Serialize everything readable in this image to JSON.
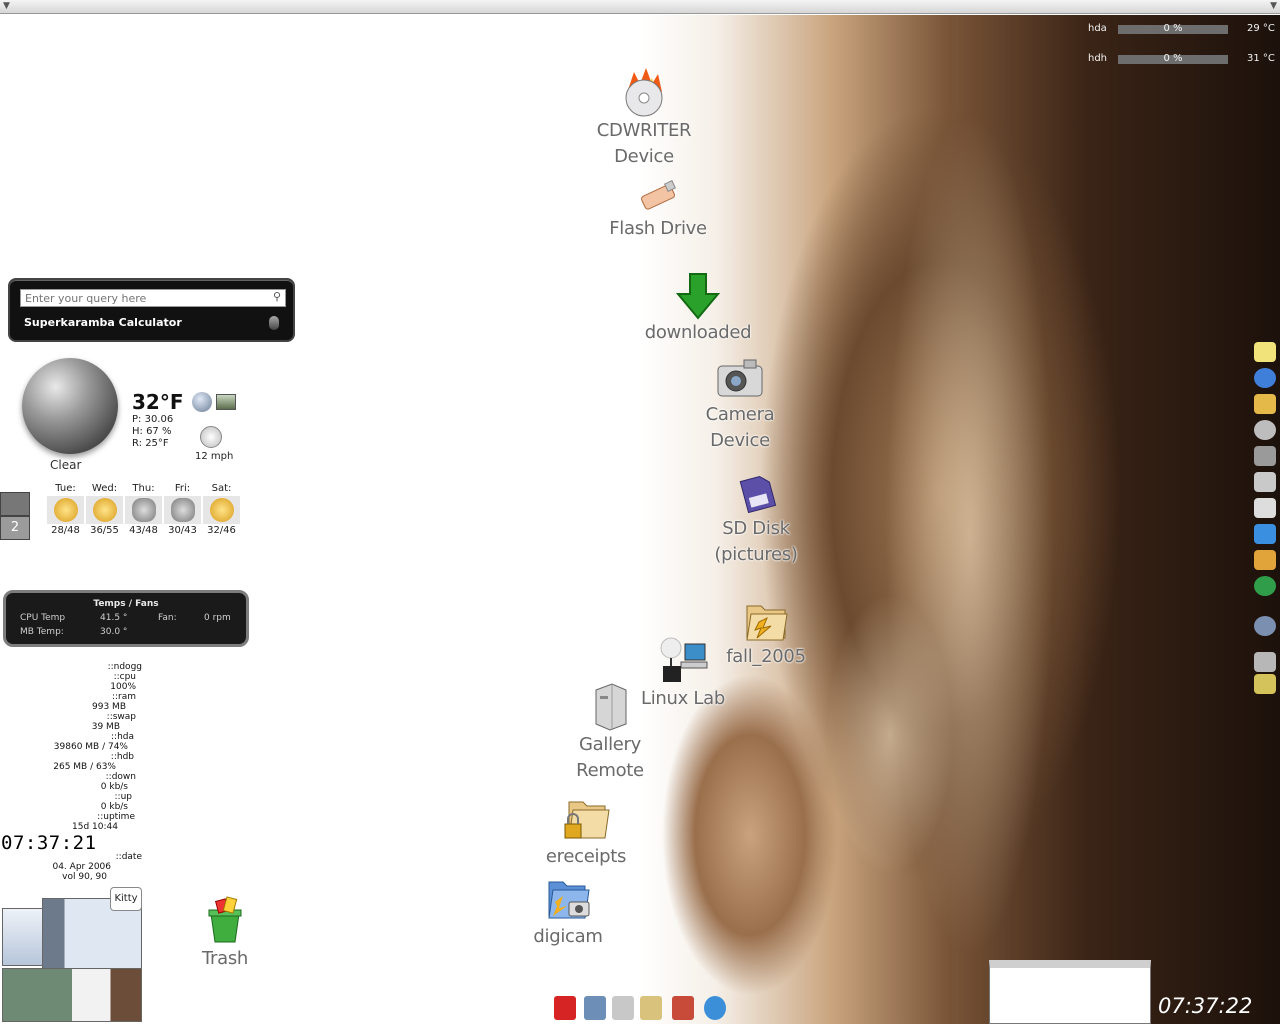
{
  "disk_monitor": [
    {
      "label": "hda",
      "percent": "0 %",
      "temp": "29 °C",
      "usage": 0
    },
    {
      "label": "hdh",
      "percent": "0 %",
      "temp": "31 °C",
      "usage": 0
    }
  ],
  "desktop_icons": [
    {
      "name": "cdwriter",
      "line1": "CDWRITER",
      "line2": "Device",
      "icon": "cd-burner-icon"
    },
    {
      "name": "flash-drive",
      "line1": "Flash Drive",
      "line2": "",
      "icon": "usb-stick-icon"
    },
    {
      "name": "downloaded",
      "line1": "downloaded",
      "line2": "",
      "icon": "download-arrow-icon"
    },
    {
      "name": "camera-device",
      "line1": "Camera",
      "line2": "Device",
      "icon": "camera-icon"
    },
    {
      "name": "sd-disk",
      "line1": "SD Disk",
      "line2": "(pictures)",
      "icon": "sd-card-icon"
    },
    {
      "name": "fall-2005",
      "line1": "fall_2005",
      "line2": "",
      "icon": "folder-icon"
    },
    {
      "name": "linux-lab",
      "line1": "Linux Lab",
      "line2": "",
      "icon": "network-computer-icon"
    },
    {
      "name": "gallery-remote",
      "line1": "Gallery",
      "line2": "Remote",
      "icon": "server-icon"
    },
    {
      "name": "ereceipts",
      "line1": "ereceipts",
      "line2": "",
      "icon": "locked-folder-icon"
    },
    {
      "name": "digicam",
      "line1": "digicam",
      "line2": "",
      "icon": "camera-folder-icon"
    },
    {
      "name": "trash",
      "line1": "Trash",
      "line2": "",
      "icon": "trash-icon"
    }
  ],
  "calculator": {
    "placeholder": "Enter your query here",
    "title": "Superkaramba Calculator"
  },
  "weather": {
    "condition": "Clear",
    "temp": "32°F",
    "pressure": "P: 30.06",
    "humidity": "H: 67 %",
    "real_feel": "R: 25°F",
    "wind": "12 mph",
    "forecast": [
      {
        "day": "Tue:",
        "range": "28/48",
        "icon": "sun-icon",
        "color": "#e2b23a"
      },
      {
        "day": "Wed:",
        "range": "36/55",
        "icon": "sun-icon",
        "color": "#e2b23a"
      },
      {
        "day": "Thu:",
        "range": "43/48",
        "icon": "cloud-icon",
        "color": "#8a8a8a"
      },
      {
        "day": "Fri:",
        "range": "30/43",
        "icon": "cloud-icon",
        "color": "#8a8a8a"
      },
      {
        "day": "Sat:",
        "range": "32/46",
        "icon": "sun-icon",
        "color": "#e2b23a"
      }
    ]
  },
  "pager": {
    "desktop2": "2"
  },
  "temps_panel": {
    "title": "Temps / Fans",
    "cpu_label": "CPU Temp",
    "cpu_value": "41.5 °",
    "fan_label": "Fan:",
    "fan_value": "0 rpm",
    "mb_label": "MB Temp:",
    "mb_value": "30.0 °"
  },
  "sysinfo": [
    "::ndogg",
    "::cpu",
    "100%",
    "::ram",
    "993 MB",
    "::swap",
    "39 MB",
    "::hda",
    "39860 MB / 74%",
    "::hdb",
    "265 MB / 63%",
    "::down",
    "0 kb/s",
    "::up",
    "0 kb/s",
    "::uptime",
    "15d 10:44"
  ],
  "clock_left": "07:37:21",
  "date_lines": [
    "::date",
    "04. Apr 2006",
    "vol 90, 90"
  ],
  "kitty_label": "Kitty",
  "clock_right": "07:37:22 am"
}
